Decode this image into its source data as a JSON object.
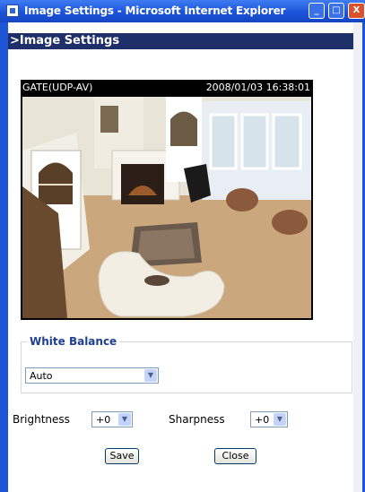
{
  "window": {
    "title": "Image Settings - Microsoft Internet Explorer",
    "minimize_glyph": "_",
    "maximize_glyph": "□",
    "close_glyph": "X"
  },
  "section_header": ">Image Settings",
  "video": {
    "camera_label": "GATE(UDP-AV)",
    "timestamp": "2008/01/03 16:38:01"
  },
  "white_balance": {
    "legend": "White Balance",
    "selected": "Auto"
  },
  "brightness": {
    "label": "Brightness",
    "selected": "+0"
  },
  "sharpness": {
    "label": "Sharpness",
    "selected": "+0"
  },
  "buttons": {
    "save": "Save",
    "close": "Close"
  },
  "icons": {
    "dropdown": "▼"
  },
  "colors": {
    "titlebar": "#1b53d9",
    "header_bar": "#1e2f6a",
    "legend_text": "#1d3f93"
  }
}
